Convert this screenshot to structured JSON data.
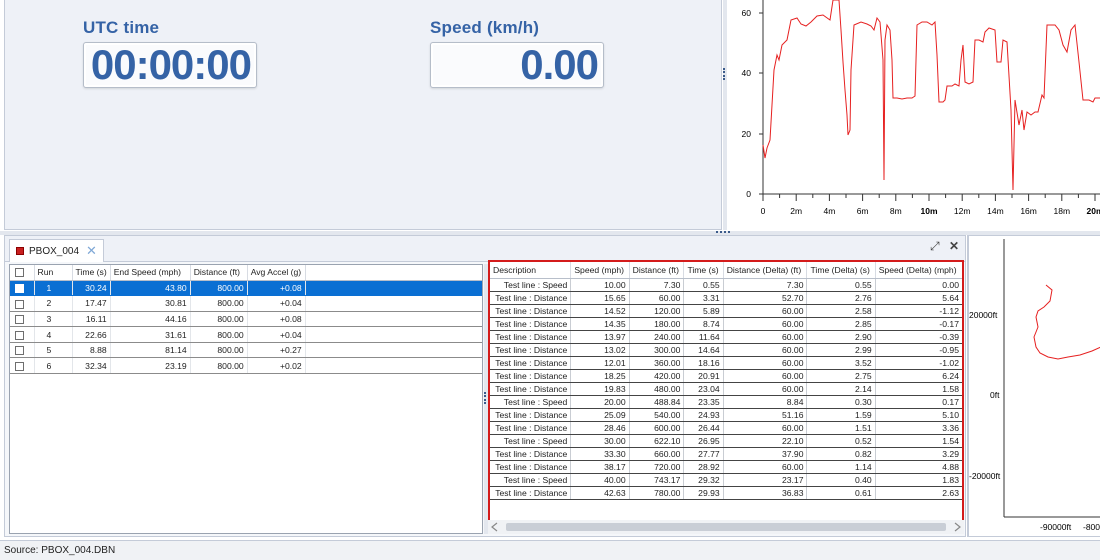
{
  "gauges": {
    "utc": {
      "label": "UTC time",
      "value": "00:00:00"
    },
    "speed": {
      "label": "Speed (km/h)",
      "value": "0.00"
    }
  },
  "speed_chart": {
    "y_ticks": [
      "0",
      "20",
      "40",
      "60"
    ],
    "x_ticks": [
      "0",
      "2m",
      "4m",
      "6m",
      "8m",
      "10m",
      "12m",
      "14m",
      "16m",
      "18m",
      "20m"
    ],
    "line_color": "#e62020"
  },
  "tab": {
    "label": "PBOX_004"
  },
  "runs_table": {
    "headers": [
      "Run",
      "Time (s)",
      "End Speed (mph)",
      "Distance (ft)",
      "Avg Accel (g)"
    ],
    "rows": [
      [
        "1",
        "30.24",
        "43.80",
        "800.00",
        "+0.08"
      ],
      [
        "2",
        "17.47",
        "30.81",
        "800.00",
        "+0.04"
      ],
      [
        "3",
        "16.11",
        "44.16",
        "800.00",
        "+0.08"
      ],
      [
        "4",
        "22.66",
        "31.61",
        "800.00",
        "+0.04"
      ],
      [
        "5",
        "8.88",
        "81.14",
        "800.00",
        "+0.27"
      ],
      [
        "6",
        "32.34",
        "23.19",
        "800.00",
        "+0.02"
      ]
    ],
    "selected_index": 0
  },
  "detail_table": {
    "headers": [
      "Description",
      "Speed (mph)",
      "Distance (ft)",
      "Time (s)",
      "Distance (Delta) (ft)",
      "Time (Delta) (s)",
      "Speed (Delta) (mph)"
    ],
    "rows": [
      [
        "Test line : Speed",
        "10.00",
        "7.30",
        "0.55",
        "7.30",
        "0.55",
        "0.00"
      ],
      [
        "Test line : Distance",
        "15.65",
        "60.00",
        "3.31",
        "52.70",
        "2.76",
        "5.64"
      ],
      [
        "Test line : Distance",
        "14.52",
        "120.00",
        "5.89",
        "60.00",
        "2.58",
        "-1.12"
      ],
      [
        "Test line : Distance",
        "14.35",
        "180.00",
        "8.74",
        "60.00",
        "2.85",
        "-0.17"
      ],
      [
        "Test line : Distance",
        "13.97",
        "240.00",
        "11.64",
        "60.00",
        "2.90",
        "-0.39"
      ],
      [
        "Test line : Distance",
        "13.02",
        "300.00",
        "14.64",
        "60.00",
        "2.99",
        "-0.95"
      ],
      [
        "Test line : Distance",
        "12.01",
        "360.00",
        "18.16",
        "60.00",
        "3.52",
        "-1.02"
      ],
      [
        "Test line : Distance",
        "18.25",
        "420.00",
        "20.91",
        "60.00",
        "2.75",
        "6.24"
      ],
      [
        "Test line : Distance",
        "19.83",
        "480.00",
        "23.04",
        "60.00",
        "2.14",
        "1.58"
      ],
      [
        "Test line : Speed",
        "20.00",
        "488.84",
        "23.35",
        "8.84",
        "0.30",
        "0.17"
      ],
      [
        "Test line : Distance",
        "25.09",
        "540.00",
        "24.93",
        "51.16",
        "1.59",
        "5.10"
      ],
      [
        "Test line : Distance",
        "28.46",
        "600.00",
        "26.44",
        "60.00",
        "1.51",
        "3.36"
      ],
      [
        "Test line : Speed",
        "30.00",
        "622.10",
        "26.95",
        "22.10",
        "0.52",
        "1.54"
      ],
      [
        "Test line : Distance",
        "33.30",
        "660.00",
        "27.77",
        "37.90",
        "0.82",
        "3.29"
      ],
      [
        "Test line : Distance",
        "38.17",
        "720.00",
        "28.92",
        "60.00",
        "1.14",
        "4.88"
      ],
      [
        "Test line : Speed",
        "40.00",
        "743.17",
        "29.32",
        "23.17",
        "0.40",
        "1.83"
      ],
      [
        "Test line : Distance",
        "42.63",
        "780.00",
        "29.93",
        "36.83",
        "0.61",
        "2.63"
      ]
    ],
    "highlight_color": "#d41b1b"
  },
  "position_chart": {
    "y_ticks": [
      "20000ft",
      "0ft",
      "-20000ft"
    ],
    "x_ticks": [
      "-90000ft",
      "-8000"
    ]
  },
  "status": {
    "text": "Source: PBOX_004.DBN"
  }
}
